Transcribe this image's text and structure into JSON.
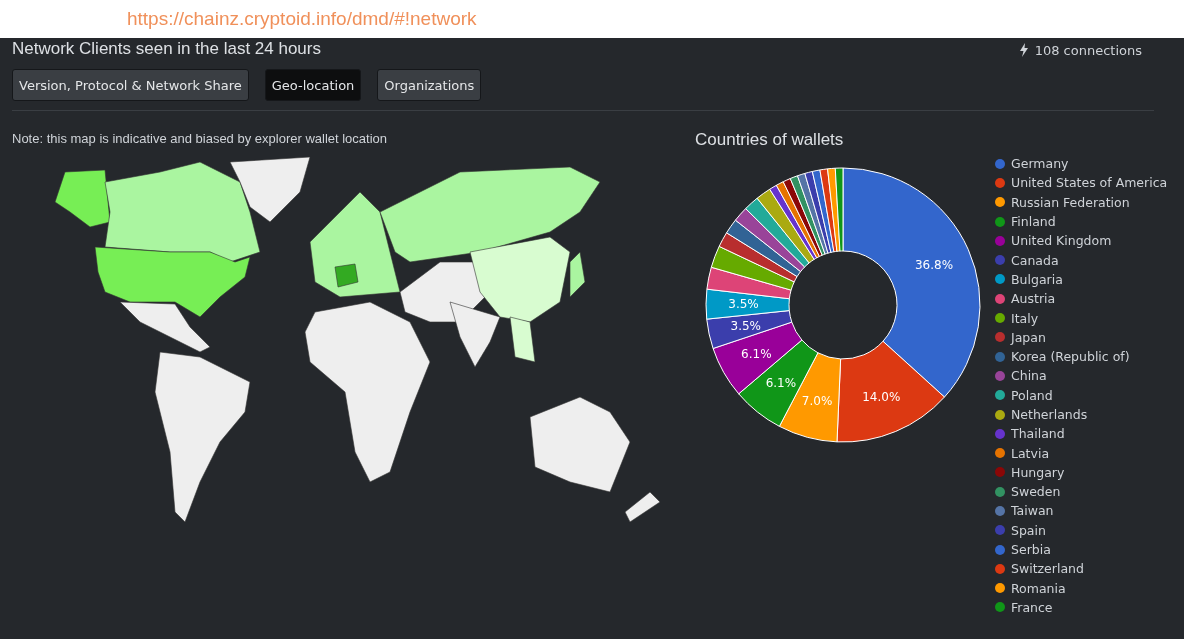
{
  "address_bar": {
    "url": "https://chainz.cryptoid.info/dmd/#!network"
  },
  "header": {
    "title": "Network Clients seen in the last 24 hours",
    "connections": "108 connections"
  },
  "tabs": [
    {
      "label": "Version, Protocol & Network Share",
      "selected": false
    },
    {
      "label": "Geo-location",
      "selected": true
    },
    {
      "label": "Organizations",
      "selected": false
    }
  ],
  "map": {
    "note": "Note: this map is indicative and biased by explorer wallet location"
  },
  "chart_data": {
    "type": "donut",
    "title": "Countries of wallets",
    "categories": [
      "Germany",
      "United States of America",
      "Russian Federation",
      "Finland",
      "United Kingdom",
      "Canada",
      "Bulgaria",
      "Austria",
      "Italy",
      "Japan",
      "Korea (Republic of)",
      "China",
      "Poland",
      "Netherlands",
      "Thailand",
      "Latvia",
      "Hungary",
      "Sweden",
      "Taiwan",
      "Spain",
      "Serbia",
      "Switzerland",
      "Romania",
      "France"
    ],
    "values": [
      36.8,
      14.0,
      7.0,
      6.1,
      6.1,
      3.5,
      3.5,
      2.6,
      2.6,
      1.8,
      1.8,
      1.8,
      1.8,
      1.8,
      0.9,
      0.9,
      0.9,
      0.9,
      0.9,
      0.9,
      0.9,
      0.9,
      0.9,
      0.9
    ],
    "colors": [
      "#3366cc",
      "#dc3912",
      "#ff9900",
      "#109618",
      "#990099",
      "#3b3eac",
      "#0099c6",
      "#dd4477",
      "#66aa00",
      "#b82e2e",
      "#316395",
      "#994499",
      "#22aa99",
      "#aaaa11",
      "#6633cc",
      "#e67300",
      "#8b0707",
      "#329262",
      "#5574a6",
      "#3b3eac",
      "#3366cc",
      "#dc3912",
      "#ff9900",
      "#109618"
    ],
    "value_labels": [
      "36.8%",
      "14.0%",
      "7.0%",
      "6.1%",
      "6.1%",
      "3.5%",
      "3.5%",
      null,
      null,
      null,
      null,
      null,
      null,
      null,
      null,
      null,
      null,
      null,
      null,
      null,
      null,
      null,
      null,
      null
    ]
  }
}
